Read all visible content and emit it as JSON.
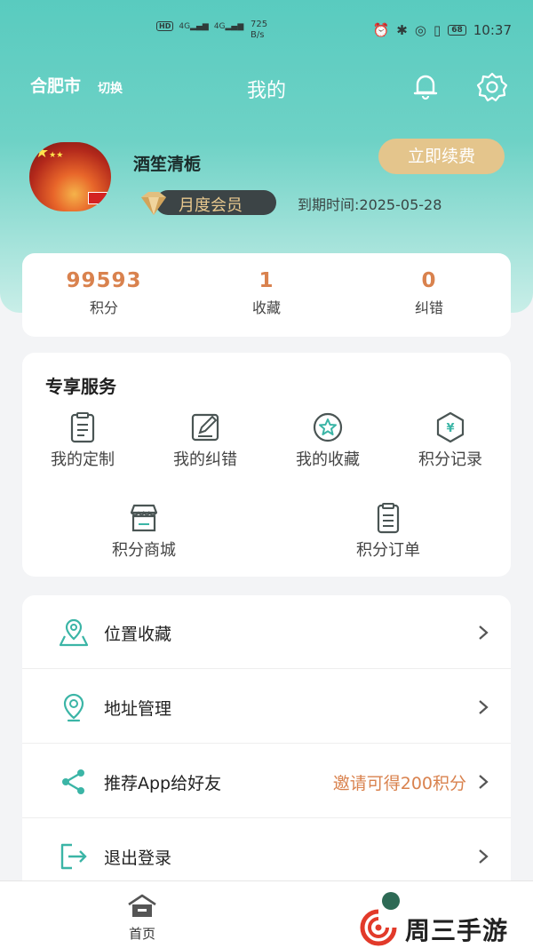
{
  "status_bar": {
    "left_badges": [
      "HD",
      "4G",
      "4G"
    ],
    "speed_value": "725",
    "speed_unit": "B/s",
    "battery": "68",
    "time": "10:37"
  },
  "header": {
    "city": "合肥市",
    "city_switch": "切换",
    "title": "我的"
  },
  "profile": {
    "username": "酒笙清栀",
    "renew_label": "立即续费",
    "member_label": "月度会员",
    "expire_text": "到期时间:2025-05-28"
  },
  "stats": [
    {
      "value": "99593",
      "label": "积分"
    },
    {
      "value": "1",
      "label": "收藏"
    },
    {
      "value": "0",
      "label": "纠错"
    }
  ],
  "services": {
    "title": "专享服务",
    "items": [
      {
        "label": "我的定制",
        "icon": "clipboard-icon"
      },
      {
        "label": "我的纠错",
        "icon": "edit-icon"
      },
      {
        "label": "我的收藏",
        "icon": "star-circle-icon"
      },
      {
        "label": "积分记录",
        "icon": "yuan-hexagon-icon"
      },
      {
        "label": "积分商城",
        "icon": "shop-icon"
      },
      {
        "label": "积分订单",
        "icon": "order-icon"
      }
    ]
  },
  "menu": [
    {
      "label": "位置收藏",
      "icon": "map-pin-icon",
      "extra": ""
    },
    {
      "label": "地址管理",
      "icon": "location-icon",
      "extra": ""
    },
    {
      "label": "推荐App给好友",
      "icon": "share-icon",
      "extra": "邀请可得200积分"
    },
    {
      "label": "退出登录",
      "icon": "logout-icon",
      "extra": ""
    }
  ],
  "bottom_nav": {
    "home_label": "首页"
  },
  "watermark": {
    "text": "周三手游网"
  },
  "colors": {
    "header_teal": "#59cbbf",
    "accent_orange": "#d9824e",
    "renew_gold": "#e4c58c",
    "icon_teal": "#3bb5a6"
  }
}
